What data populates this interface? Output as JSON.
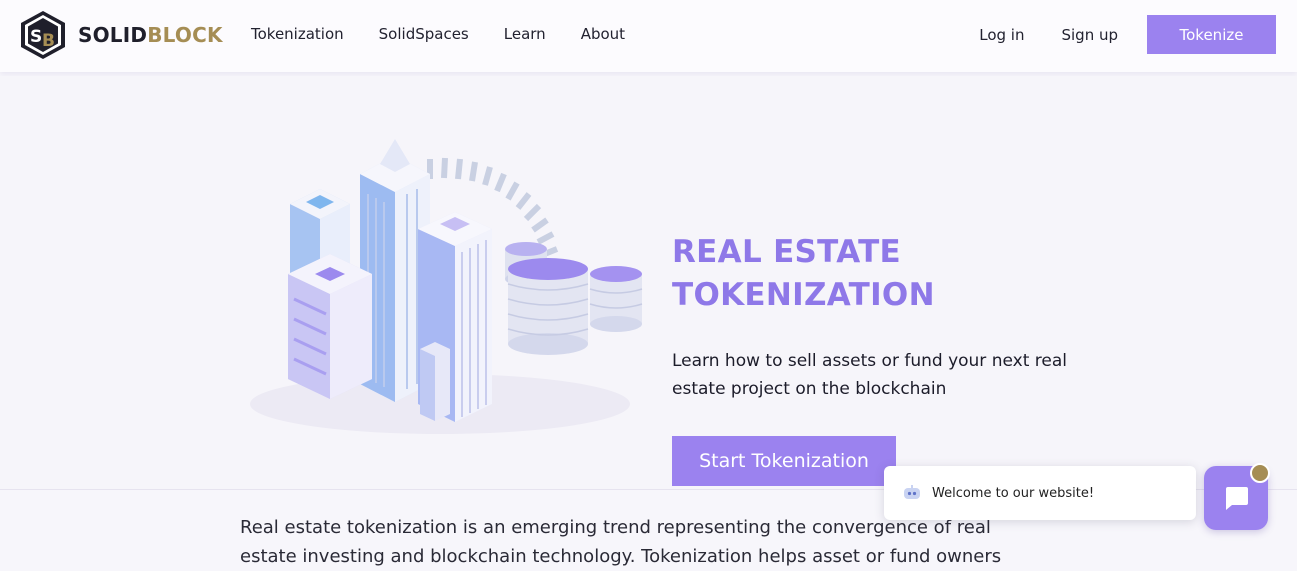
{
  "brand": {
    "name_part1": "SOLID",
    "name_part2": "BLOCK",
    "accent_color": "#a58d54"
  },
  "nav": {
    "items": [
      "Tokenization",
      "SolidSpaces",
      "Learn",
      "About"
    ]
  },
  "header_actions": {
    "login": "Log in",
    "signup": "Sign up",
    "tokenize": "Tokenize"
  },
  "hero": {
    "title_line1": "REAL ESTATE",
    "title_line2": "TOKENIZATION",
    "subtitle": "Learn how to sell assets or fund your next real estate project on the blockchain",
    "cta": "Start Tokenization"
  },
  "intro": {
    "text": "Real estate tokenization is an emerging trend representing the convergence of real estate investing and blockchain technology. Tokenization helps asset or fund owners"
  },
  "chat": {
    "welcome": "Welcome to our website!"
  },
  "colors": {
    "primary": "#9b82ef",
    "title": "#8e78e8",
    "gold": "#a58d54"
  }
}
